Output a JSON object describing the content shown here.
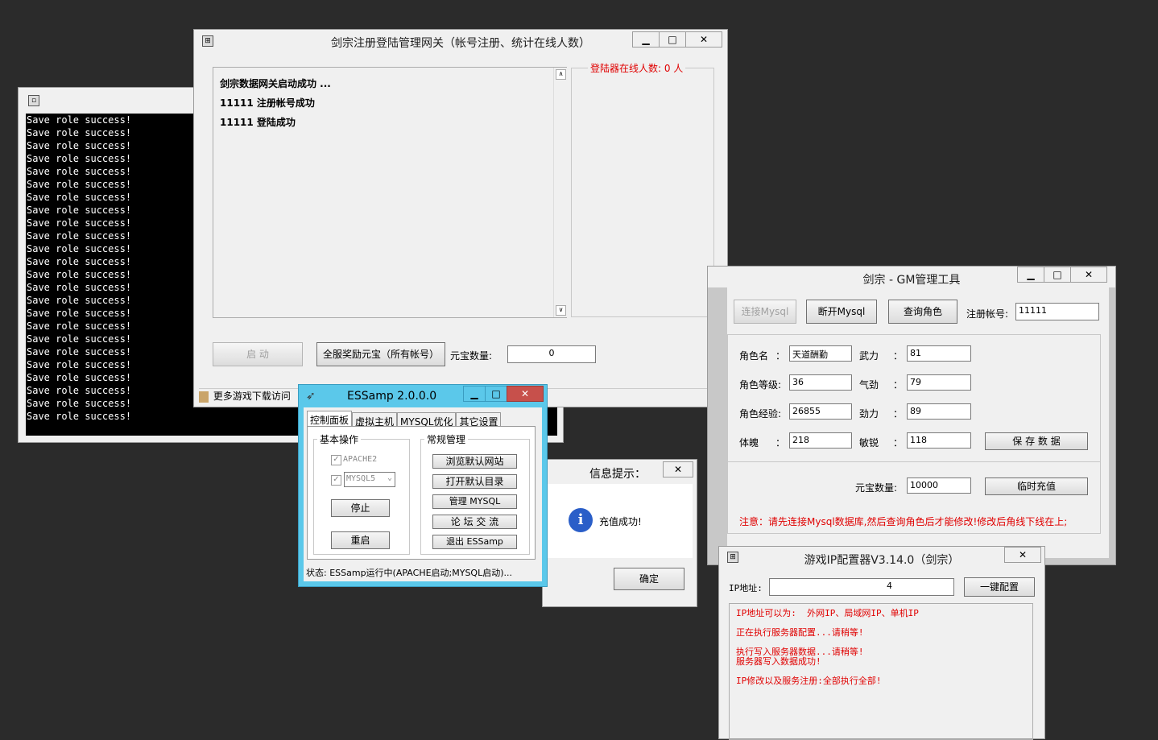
{
  "console": {
    "lines": [
      "Save role success!",
      "Save role success!",
      "Save role success!",
      "Save role success!",
      "Save role success!",
      "Save role success!",
      "Save role success!",
      "Save role success!",
      "Save role success!",
      "Save role success!",
      "Save role success!",
      "Save role success!",
      "Save role success!",
      "Save role success!",
      "Save role success!",
      "Save role success!",
      "Save role success!",
      "Save role success!",
      "Save role success!",
      "Save role success!",
      "Save role success!",
      "Save role success!",
      "Save role success!",
      "Save role success!"
    ]
  },
  "gateway": {
    "title": "剑宗注册登陆管理网关（帐号注册、统计在线人数）",
    "log": [
      "剑宗数据网关启动成功 ...",
      "11111  注册帐号成功",
      "11111  登陆成功"
    ],
    "online_label": "登陆器在线人数:  0  人",
    "start_button": "启 动",
    "reward_button": "全服奖励元宝（所有帐号）",
    "yuanbao_label": "元宝数量:",
    "yuanbao_value": "0",
    "status_text": "更多游戏下载访问"
  },
  "essamp": {
    "title": "ESSamp 2.0.0.0",
    "tabs": [
      "控制面板",
      "虚拟主机",
      "MYSQL优化",
      "其它设置"
    ],
    "basic_group": "基本操作",
    "apache_label": "APACHE2",
    "mysql_select": "MYSQL5",
    "stop_button": "停止",
    "restart_button": "重启",
    "regular_group": "常规管理",
    "actions": [
      "浏览默认网站",
      "打开默认目录",
      "管理  MYSQL",
      "论 坛 交 流",
      "退出  ESSamp"
    ],
    "status": "状态: ESSamp运行中(APACHE启动;MYSQL启动)..."
  },
  "msgbox": {
    "title": "信息提示：",
    "message": "充值成功!",
    "ok_button": "确定"
  },
  "gm": {
    "title": "剑宗 - GM管理工具",
    "connect_button": "连接Mysql",
    "disconnect_button": "断开Mysql",
    "query_button": "查询角色",
    "account_label": "注册帐号:",
    "account_value": "11111",
    "fields": {
      "name_label": "角色名",
      "name_value": "天道酬勤",
      "level_label": "角色等级:",
      "level_value": "36",
      "exp_label": "角色经验:",
      "exp_value": "26855",
      "body_label": "体魄",
      "body_value": "218",
      "force_label": "武力",
      "force_value": "81",
      "qi_label": "气劲",
      "qi_value": "79",
      "jin_label": "劲力",
      "jin_value": "89",
      "agile_label": "敏锐",
      "agile_value": "118"
    },
    "colon": "：",
    "save_button": "保 存 数 据",
    "yuanbao_label": "元宝数量:",
    "yuanbao_value": "10000",
    "recharge_button": "临时充值",
    "notice": "注意：请先连接Mysql数据库,然后查询角色后才能修改!修改后角线下线在上;"
  },
  "ipconf": {
    "title": "游戏IP配置器V3.14.0（剑宗）",
    "ip_label": "IP地址:",
    "ip_value": "4",
    "config_button": "一键配置",
    "messages": [
      "IP地址可以为:  外网IP、局域网IP、单机IP",
      "正在执行服务器配置...请稍等!",
      "执行写入服务器数据...请稍等!",
      "服务器写入数据成功!",
      "IP修改以及服务注册:全部执行全部!"
    ]
  },
  "colors": {
    "red": "#e00000",
    "essamp_frame": "#5bc8ea",
    "console_bg": "#000000"
  }
}
